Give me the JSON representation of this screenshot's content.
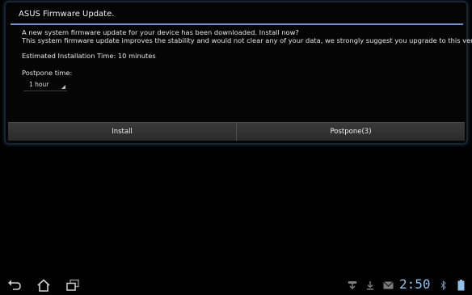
{
  "dialog": {
    "title": "ASUS Firmware Update.",
    "message_line_1": "A new system firmware update for your device has been downloaded. Install now?",
    "message_line_2": "This system firmware update improves the stability and would not clear any of your data, we strongly suggest you upgrade to this version.",
    "estimated_time": "Estimated Installation Time: 10 minutes",
    "postpone_label": "Postpone time:",
    "postpone_value": "1 hour",
    "install_label": "Install",
    "postpone_button_label": "Postpone(3)"
  },
  "status_bar": {
    "clock": "2:50",
    "icons": [
      "usb-icon",
      "download-icon",
      "mail-icon",
      "bluetooth-icon",
      "battery-icon"
    ],
    "accent_color": "#8fc0ea"
  },
  "nav_bar": {
    "icons": [
      "back-icon",
      "home-icon",
      "recent-apps-icon"
    ]
  },
  "colors": {
    "background": "#000000",
    "title_divider": "#6d93cc",
    "dialog_glow": "#23384f"
  }
}
